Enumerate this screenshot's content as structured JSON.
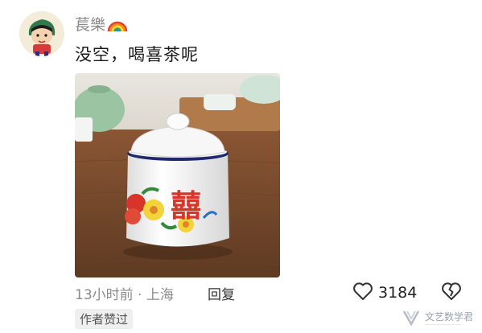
{
  "comment": {
    "username": "萇樂",
    "badge_emoji_icon": "rainbow-icon",
    "text": "没空，喝喜茶呢",
    "time_location": "13小时前 · 上海",
    "reply_label": "回复",
    "like_count": "3184",
    "author_liked_badge": "作者赞过"
  },
  "photo": {
    "mug_char": "囍"
  },
  "watermark": {
    "text": "文艺数学君"
  },
  "colors": {
    "meta_gray": "#8b8b8b",
    "mug_red": "#d8352a",
    "mug_rim_blue": "#1f2a6b",
    "table_brown": "#7a4a2c"
  }
}
